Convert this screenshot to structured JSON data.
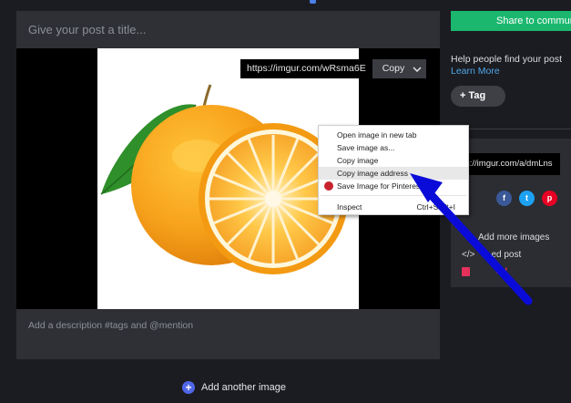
{
  "editor": {
    "title_placeholder": "Give your post a title...",
    "description_placeholder": "Add a description #tags and @mention",
    "image_link": "https://imgur.com/wRsma6E",
    "copy_label": "Copy",
    "add_another_label": "Add another image"
  },
  "sidebar": {
    "share_label": "Share to communi",
    "help_text": "Help people find your post",
    "learn_more": "Learn More",
    "tag_label": "Tag",
    "share_url": "s://imgur.com/a/dmLns",
    "socials": [
      {
        "name": "facebook",
        "glyph": "f",
        "color": "#3b5998"
      },
      {
        "name": "twitter",
        "glyph": "t",
        "color": "#1da1f2"
      },
      {
        "name": "pinterest",
        "glyph": "p",
        "color": "#e60023"
      }
    ],
    "add_more_label": "Add more images",
    "embed_label": "ed post",
    "delete_label": "ost"
  },
  "context_menu": {
    "items": [
      "Open image in new tab",
      "Save image as...",
      "Copy image",
      "Copy image address",
      "Save Image for Pinterest",
      "Inspect"
    ],
    "highlighted_index": 3,
    "inspect_shortcut": "Ctrl+Shift+I"
  },
  "colors": {
    "accent_green": "#1bb76e",
    "annotation_arrow": "#0000ee",
    "link_blue": "#4fa6e8",
    "danger": "#e3315b"
  }
}
